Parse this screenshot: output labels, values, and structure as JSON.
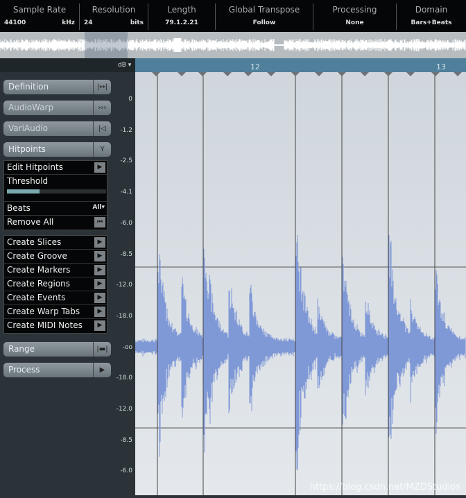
{
  "info_bar": [
    {
      "label": "Sample Rate",
      "value": "44100",
      "unit": "kHz"
    },
    {
      "label": "Resolution",
      "value": "24",
      "unit": "bits"
    },
    {
      "label": "Length",
      "value": "79.1.2.21"
    },
    {
      "label": "Global Transpose",
      "value": "Follow"
    },
    {
      "label": "Processing",
      "value": "None"
    },
    {
      "label": "Domain",
      "value": "Bars+Beats"
    }
  ],
  "scale_unit": "dB",
  "ruler_labels": [
    "12",
    "13"
  ],
  "db_ticks": [
    "0",
    "-1.2",
    "-2.5",
    "-4.1",
    "-6.0",
    "-8.5",
    "-12.0",
    "-18.0",
    "-oo",
    "-18.0",
    "-12.0",
    "-8.5",
    "-6.0"
  ],
  "sections": {
    "definition": "Definition",
    "audiowarp": "AudioWarp",
    "variaudio": "VariAudio",
    "hitpoints": "Hitpoints",
    "range": "Range",
    "process": "Process"
  },
  "hitpoints": {
    "edit": "Edit Hitpoints",
    "threshold": "Threshold",
    "threshold_level": 0.33,
    "beats": "Beats",
    "beats_value": "All",
    "remove_all": "Remove All"
  },
  "create_actions": [
    "Create Slices",
    "Create Groove",
    "Create Markers",
    "Create Regions",
    "Create Events",
    "Create Warp Tabs",
    "Create MIDI Notes"
  ],
  "watermark": "https://blog.csdn.net/MZDStudios",
  "colors": {
    "waveform": "#7f98d6",
    "ruler": "#4f7f9a"
  }
}
